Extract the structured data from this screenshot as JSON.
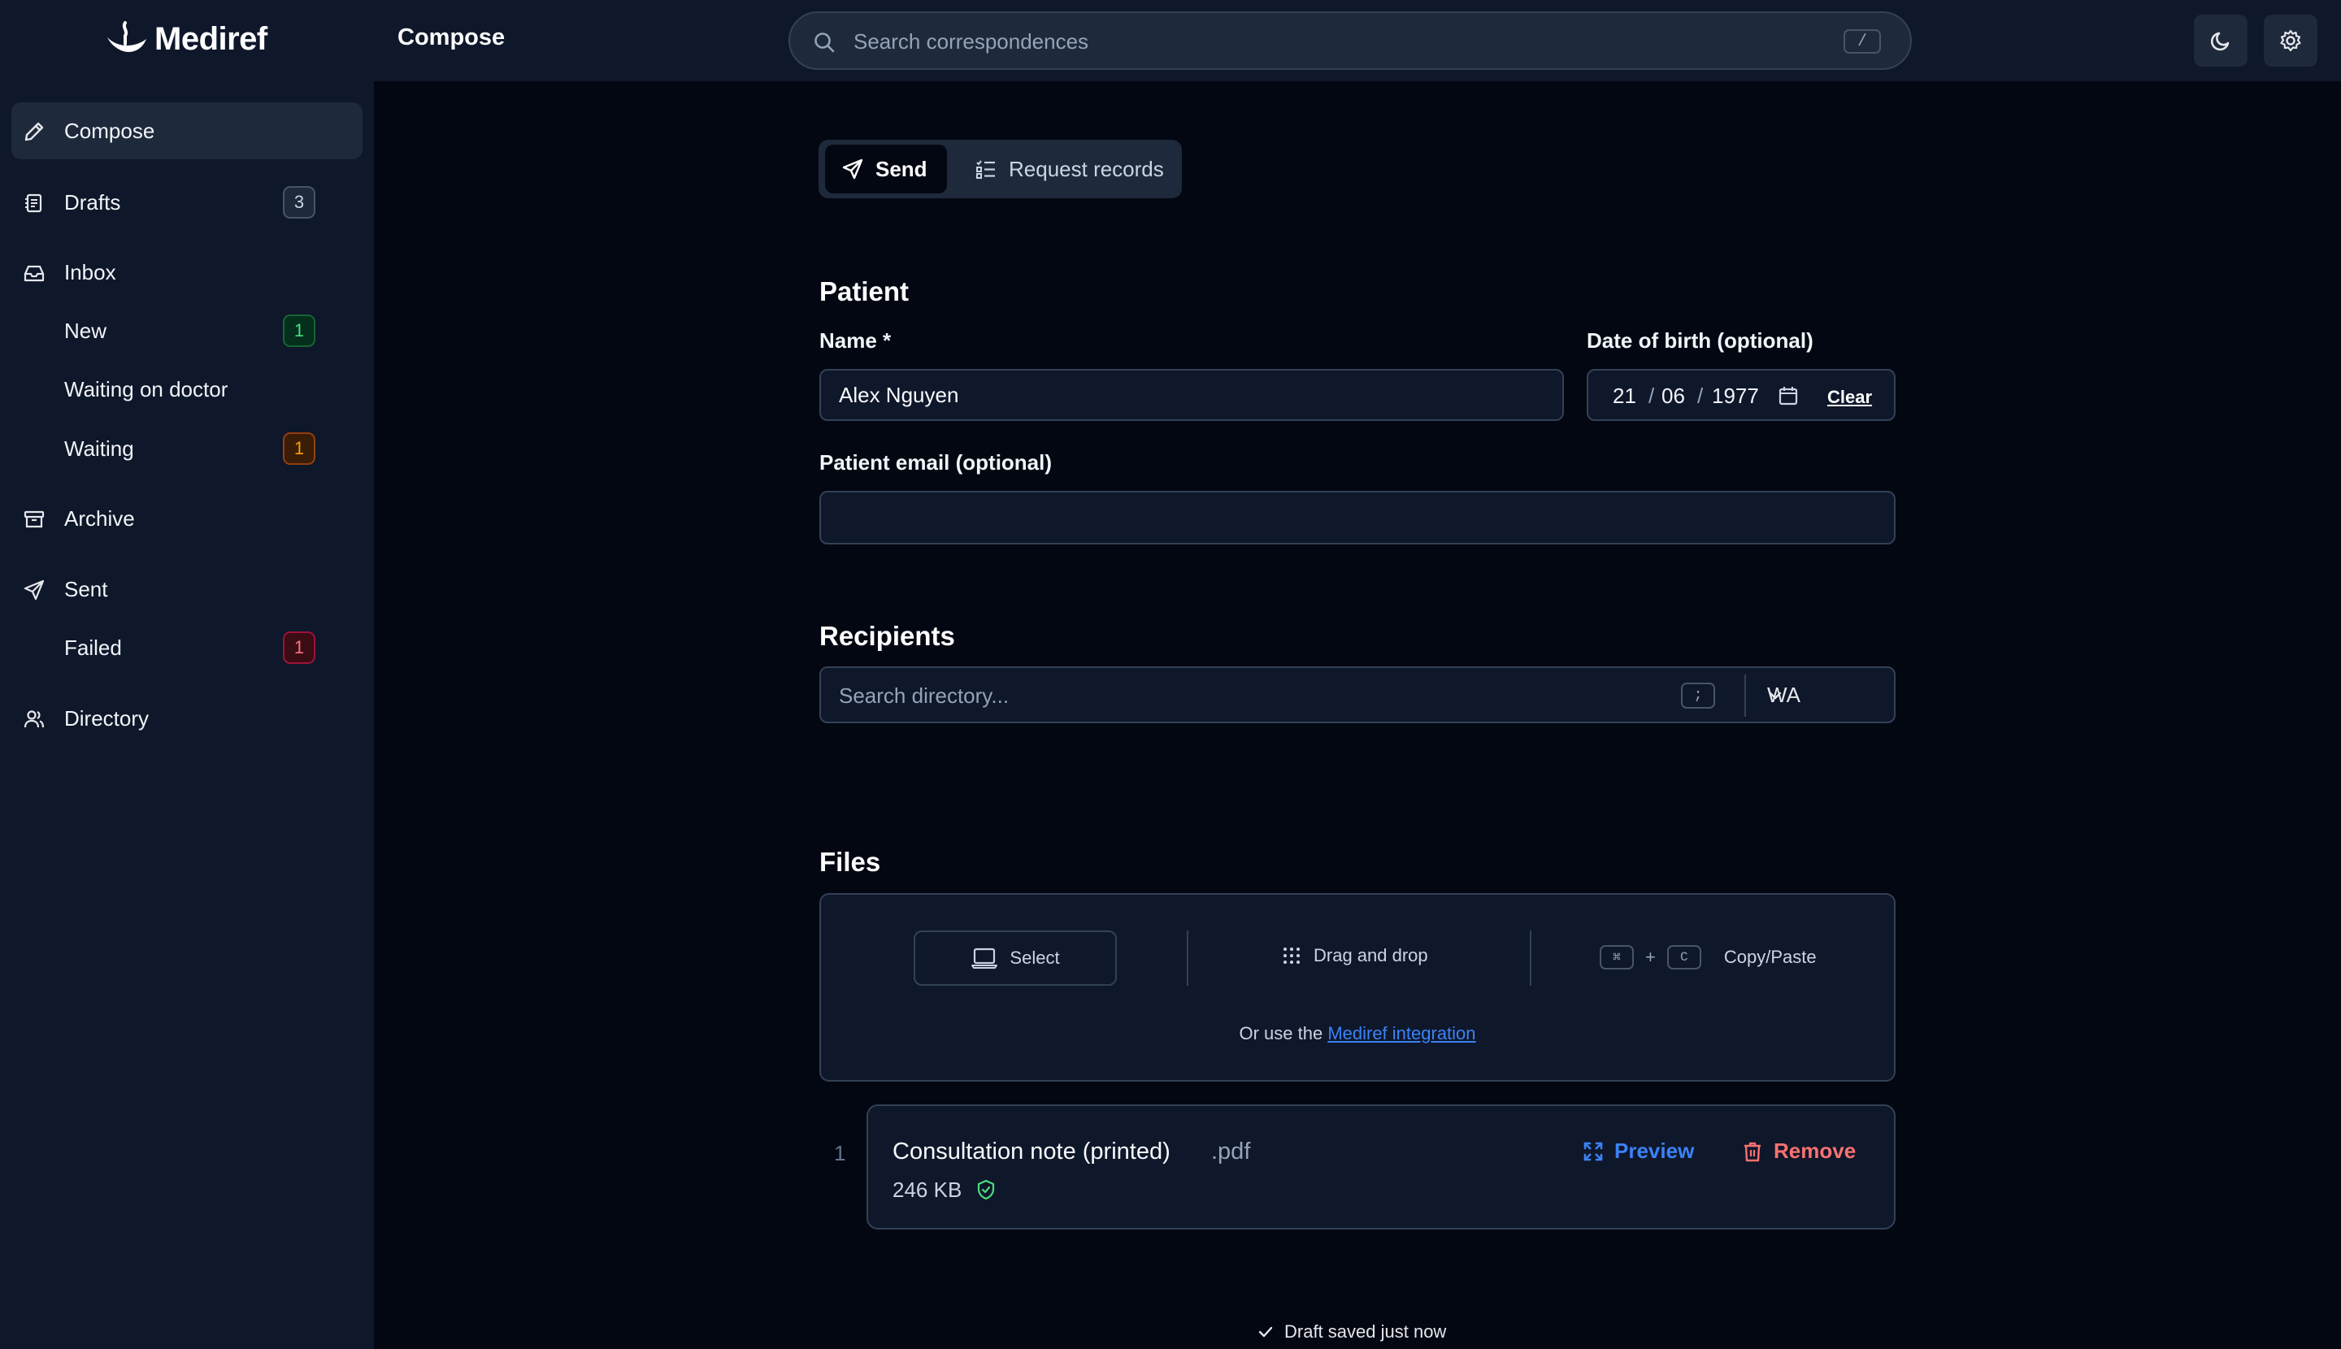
{
  "app": {
    "logo_text": "Mediref",
    "page_title": "Compose"
  },
  "header": {
    "search_placeholder": "Search correspondences",
    "search_shortcut": "/",
    "theme_icon": "moon-icon",
    "settings_icon": "gear-icon"
  },
  "sidebar": {
    "items": [
      {
        "label": "Compose",
        "icon": "pencil-icon",
        "active": true
      },
      {
        "label": "Drafts",
        "icon": "drafts-icon",
        "badge": "3"
      },
      {
        "label": "Inbox",
        "icon": "inbox-icon"
      },
      {
        "label": "New",
        "badge": "1"
      },
      {
        "label": "Waiting on doctor"
      },
      {
        "label": "Waiting",
        "badge": "1"
      },
      {
        "label": "Archive",
        "icon": "archive-icon"
      },
      {
        "label": "Sent",
        "icon": "send-icon"
      },
      {
        "label": "Failed",
        "badge": "1"
      },
      {
        "label": "Directory",
        "icon": "users-icon"
      }
    ]
  },
  "mode_tabs": {
    "send_label": "Send",
    "request_label": "Request records"
  },
  "patient": {
    "section_title": "Patient",
    "name_label": "Name *",
    "name_value": "Alex Nguyen",
    "dob_label": "Date of birth (optional)",
    "dob_day": "21",
    "dob_month": "06",
    "dob_year": "1977",
    "dob_clear": "Clear",
    "email_label": "Patient email (optional)",
    "email_value": ""
  },
  "recipients": {
    "section_title": "Recipients",
    "search_placeholder": "Search directory...",
    "shortcut": ";",
    "state_value": "WA"
  },
  "files": {
    "section_title": "Files",
    "select_label": "Select",
    "drag_label": "Drag and drop",
    "paste_key_1": "⌘",
    "paste_plus": "+",
    "paste_key_2": "C",
    "paste_label": "Copy/Paste",
    "integration_prefix": "Or use the ",
    "integration_link": "Mediref integration",
    "list": [
      {
        "index": "1",
        "name": "Consultation note (printed)",
        "ext": ".pdf",
        "size": "246 KB",
        "preview_label": "Preview",
        "remove_label": "Remove"
      }
    ]
  },
  "status": {
    "draft_saved": "Draft saved just now"
  },
  "colors": {
    "background": "#030712",
    "panel": "#0f172a",
    "accent_blue": "#3b82f6",
    "danger_red": "#f87171"
  }
}
